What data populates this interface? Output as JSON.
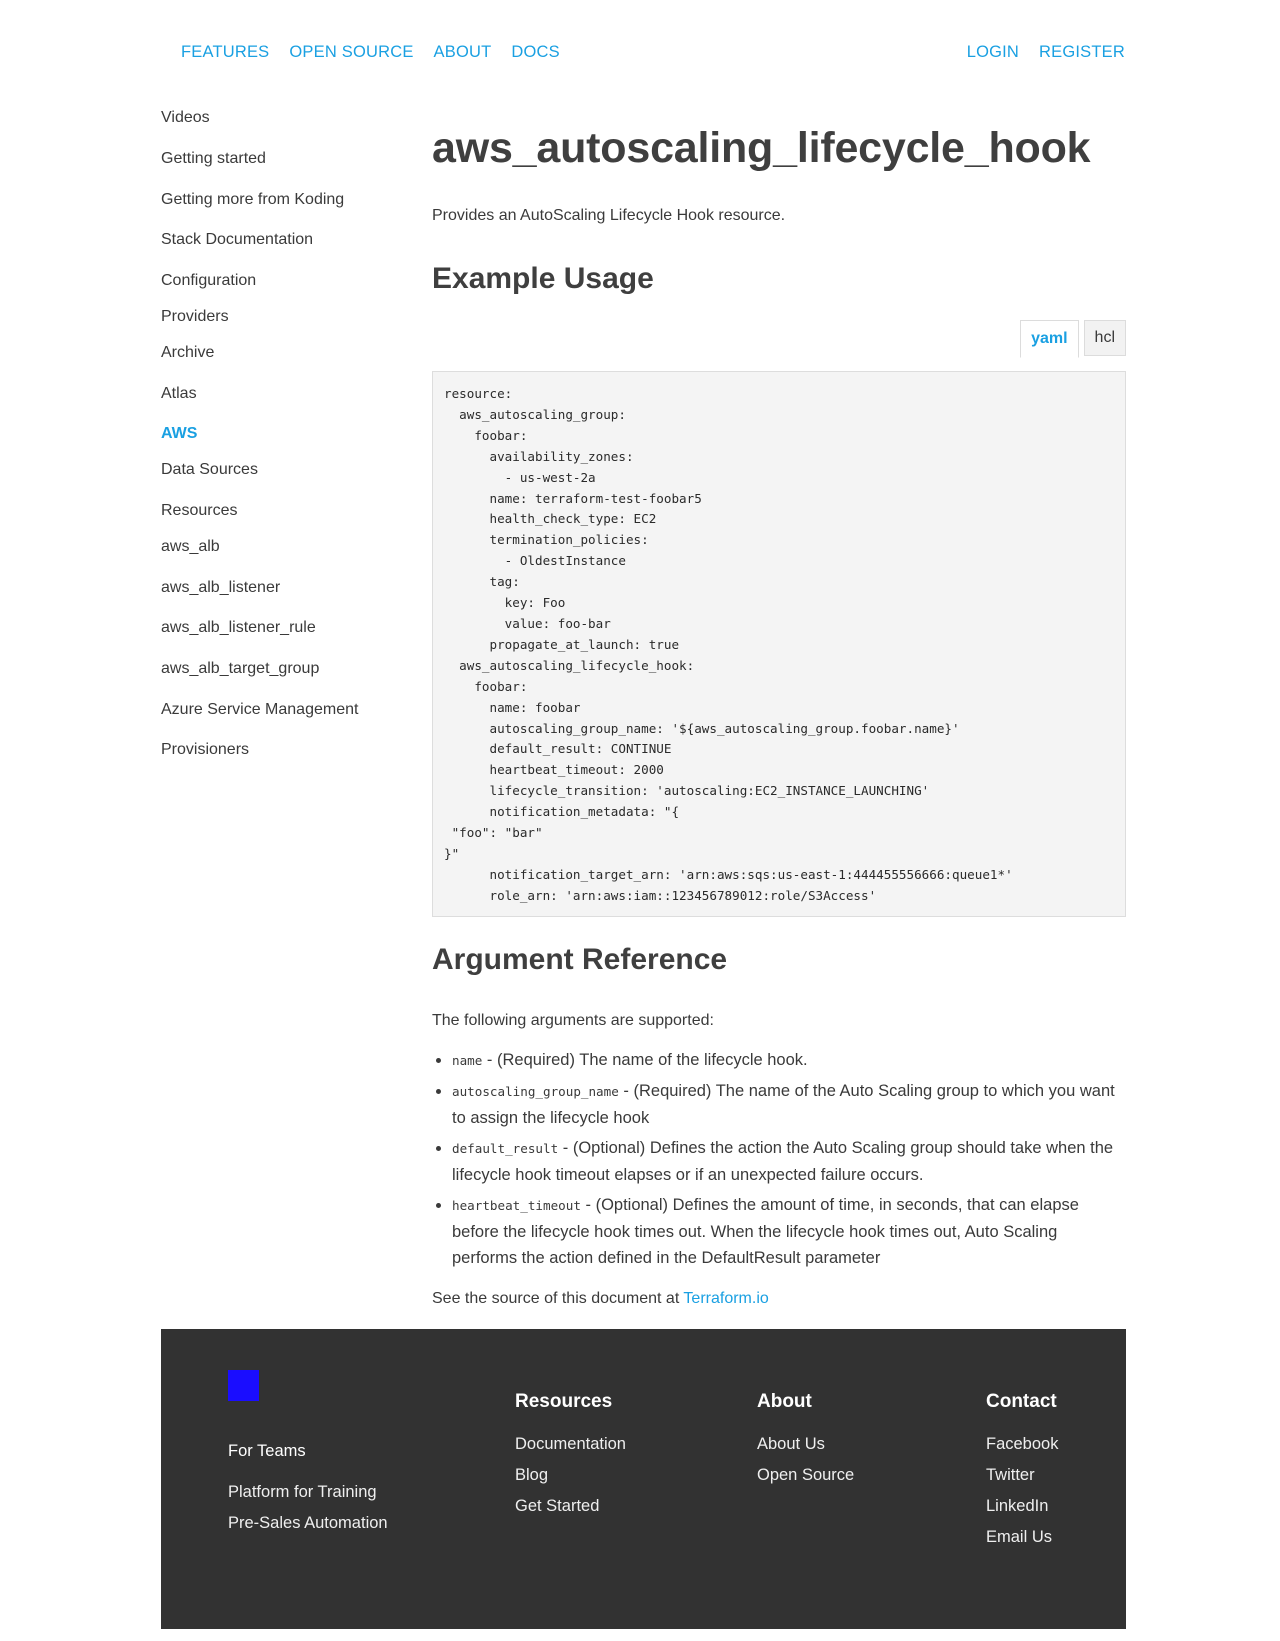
{
  "nav": {
    "left": [
      "FEATURES",
      "OPEN SOURCE",
      "ABOUT",
      "DOCS"
    ],
    "right": [
      "LOGIN",
      "REGISTER"
    ]
  },
  "sidebar": {
    "items": [
      "Videos",
      "Getting started",
      "Getting more from Koding",
      "Stack Documentation",
      "Configuration",
      "Providers",
      "Archive",
      "Atlas",
      "AWS",
      "Data Sources",
      "Resources",
      "aws_alb",
      "aws_alb_listener",
      "aws_alb_listener_rule",
      "aws_alb_target_group",
      "Azure Service Management",
      "Provisioners"
    ],
    "active": "AWS"
  },
  "main": {
    "title": "aws_autoscaling_lifecycle_hook",
    "intro": "Provides an AutoScaling Lifecycle Hook resource.",
    "example_heading": "Example Usage",
    "tabs": [
      "yaml",
      "hcl"
    ],
    "active_tab": "yaml",
    "code": "resource:\n  aws_autoscaling_group:\n    foobar:\n      availability_zones:\n        - us-west-2a\n      name: terraform-test-foobar5\n      health_check_type: EC2\n      termination_policies:\n        - OldestInstance\n      tag:\n        key: Foo\n        value: foo-bar\n      propagate_at_launch: true\n  aws_autoscaling_lifecycle_hook:\n    foobar:\n      name: foobar\n      autoscaling_group_name: '${aws_autoscaling_group.foobar.name}'\n      default_result: CONTINUE\n      heartbeat_timeout: 2000\n      lifecycle_transition: 'autoscaling:EC2_INSTANCE_LAUNCHING'\n      notification_metadata: \"{\n \"foo\": \"bar\"\n}\"\n      notification_target_arn: 'arn:aws:sqs:us-east-1:444455556666:queue1*'\n      role_arn: 'arn:aws:iam::123456789012:role/S3Access'",
    "args_heading": "Argument Reference",
    "args_intro": "The following arguments are supported:",
    "args": [
      {
        "code": "name",
        "text": " - (Required) The name of the lifecycle hook."
      },
      {
        "code": "autoscaling_group_name",
        "text": " - (Required) The name of the Auto Scaling group to which you want to assign the lifecycle hook"
      },
      {
        "code": "default_result",
        "text": " - (Optional) Defines the action the Auto Scaling group should take when the lifecycle hook timeout elapses or if an unexpected failure occurs."
      },
      {
        "code": "heartbeat_timeout",
        "text": " - (Optional) Defines the amount of time, in seconds, that can elapse before the lifecycle hook times out. When the lifecycle hook times out, Auto Scaling performs the action defined in the DefaultResult parameter"
      }
    ],
    "source_prefix": "See the source of this document at ",
    "source_link": "Terraform.io"
  },
  "footer": {
    "logo_color": "#1a0dff",
    "teams": {
      "heading": "For Teams",
      "links": [
        "Platform for Training",
        "Pre-Sales Automation"
      ]
    },
    "resources": {
      "heading": "Resources",
      "links": [
        "Documentation",
        "Blog",
        "Get Started"
      ]
    },
    "about": {
      "heading": "About",
      "links": [
        "About Us",
        "Open Source"
      ]
    },
    "contact": {
      "heading": "Contact",
      "links": [
        "Facebook",
        "Twitter",
        "LinkedIn",
        "Email Us"
      ]
    }
  },
  "colors": {
    "accent": "#1aa0e2",
    "text": "#3a3a3a",
    "footer_bg": "#323232",
    "code_bg": "#f4f4f4"
  }
}
